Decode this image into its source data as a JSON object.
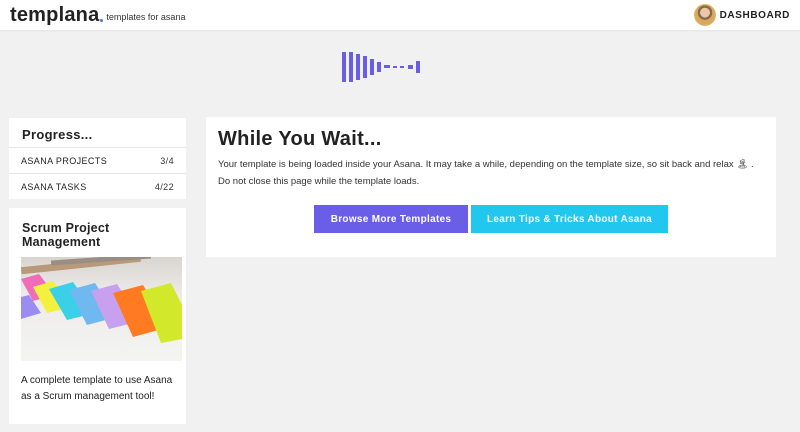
{
  "header": {
    "brand_name": "templana",
    "brand_tagline": "templates for asana",
    "dashboard_label": "DASHBOARD"
  },
  "progress": {
    "title": "Progress...",
    "rows": [
      {
        "label": "ASANA PROJECTS",
        "count": "3/4"
      },
      {
        "label": "ASANA TASKS",
        "count": "4/22"
      }
    ]
  },
  "template_card": {
    "title": "Scrum Project Management",
    "description": "A complete template to use Asana as a Scrum management tool!"
  },
  "wait": {
    "title": "While You Wait...",
    "line1": "Your template is being loaded inside your Asana. It may take a while, depending on the template size, so sit back and relax 🏝 .",
    "line2": "Do not close this page while the template loads.",
    "browse_label": "Browse More Templates",
    "learn_label": "Learn Tips & Tricks About Asana"
  },
  "colors": {
    "accent_purple": "#6a5de8",
    "accent_cyan": "#22c7f0",
    "background": "#f1f1f1"
  }
}
